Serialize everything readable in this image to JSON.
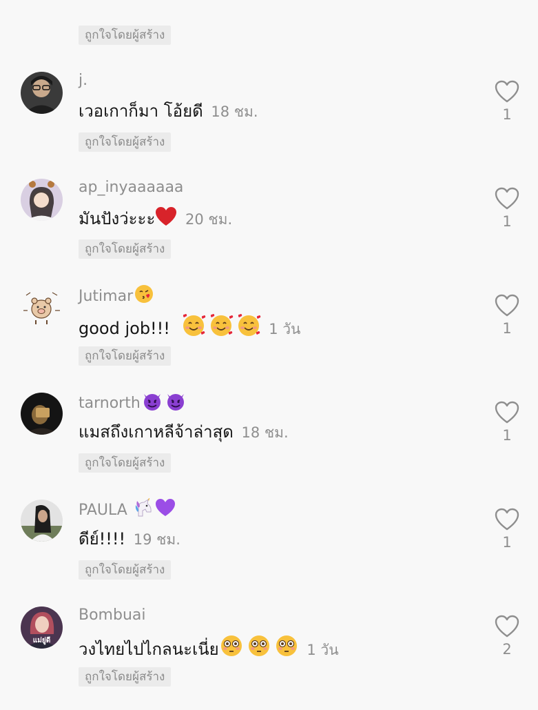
{
  "creator_liked_label": "ถูกใจโดยผู้สร้าง",
  "comments": [
    {
      "username": "j.",
      "text": "เวอเกาก็มา โอ้ยดี",
      "time": "18 ชม.",
      "likes": "1",
      "avatar": "person-dark-avatar"
    },
    {
      "username": "ap_inyaaaaaa",
      "text": "มันปังว่ะะะ",
      "emoji": "red-heart",
      "time": "20 ชม.",
      "likes": "1",
      "avatar": "girl-deer-filter-avatar"
    },
    {
      "username": "Jutimar",
      "username_emoji": "face-blowing-kiss",
      "text": "good job!!!",
      "emoji": "smiling-face-with-hearts x3",
      "time": "1 วัน",
      "likes": "1",
      "avatar": "cartoon-pig-avatar"
    },
    {
      "username": "tarnorth",
      "username_emoji": "smiling-devil x2",
      "text": "แมสถึงเกาหลีจ้าล่าสุด",
      "time": "18 ชม.",
      "likes": "1",
      "avatar": "person-dark-avatar"
    },
    {
      "username": "PAULA",
      "username_emoji": "unicorn, purple-heart",
      "text": "ดีย์!!!!",
      "time": "19 ชม.",
      "likes": "1",
      "avatar": "person-hair-avatar"
    },
    {
      "username": "Bombuai",
      "text": "วงไทยไปไกลนะเนี่ย",
      "emoji": "flushed-face x3",
      "time": "1 วัน",
      "likes": "2",
      "avatar": "person-pink-avatar",
      "avatar_text": "แม่ยู่ดี"
    }
  ]
}
